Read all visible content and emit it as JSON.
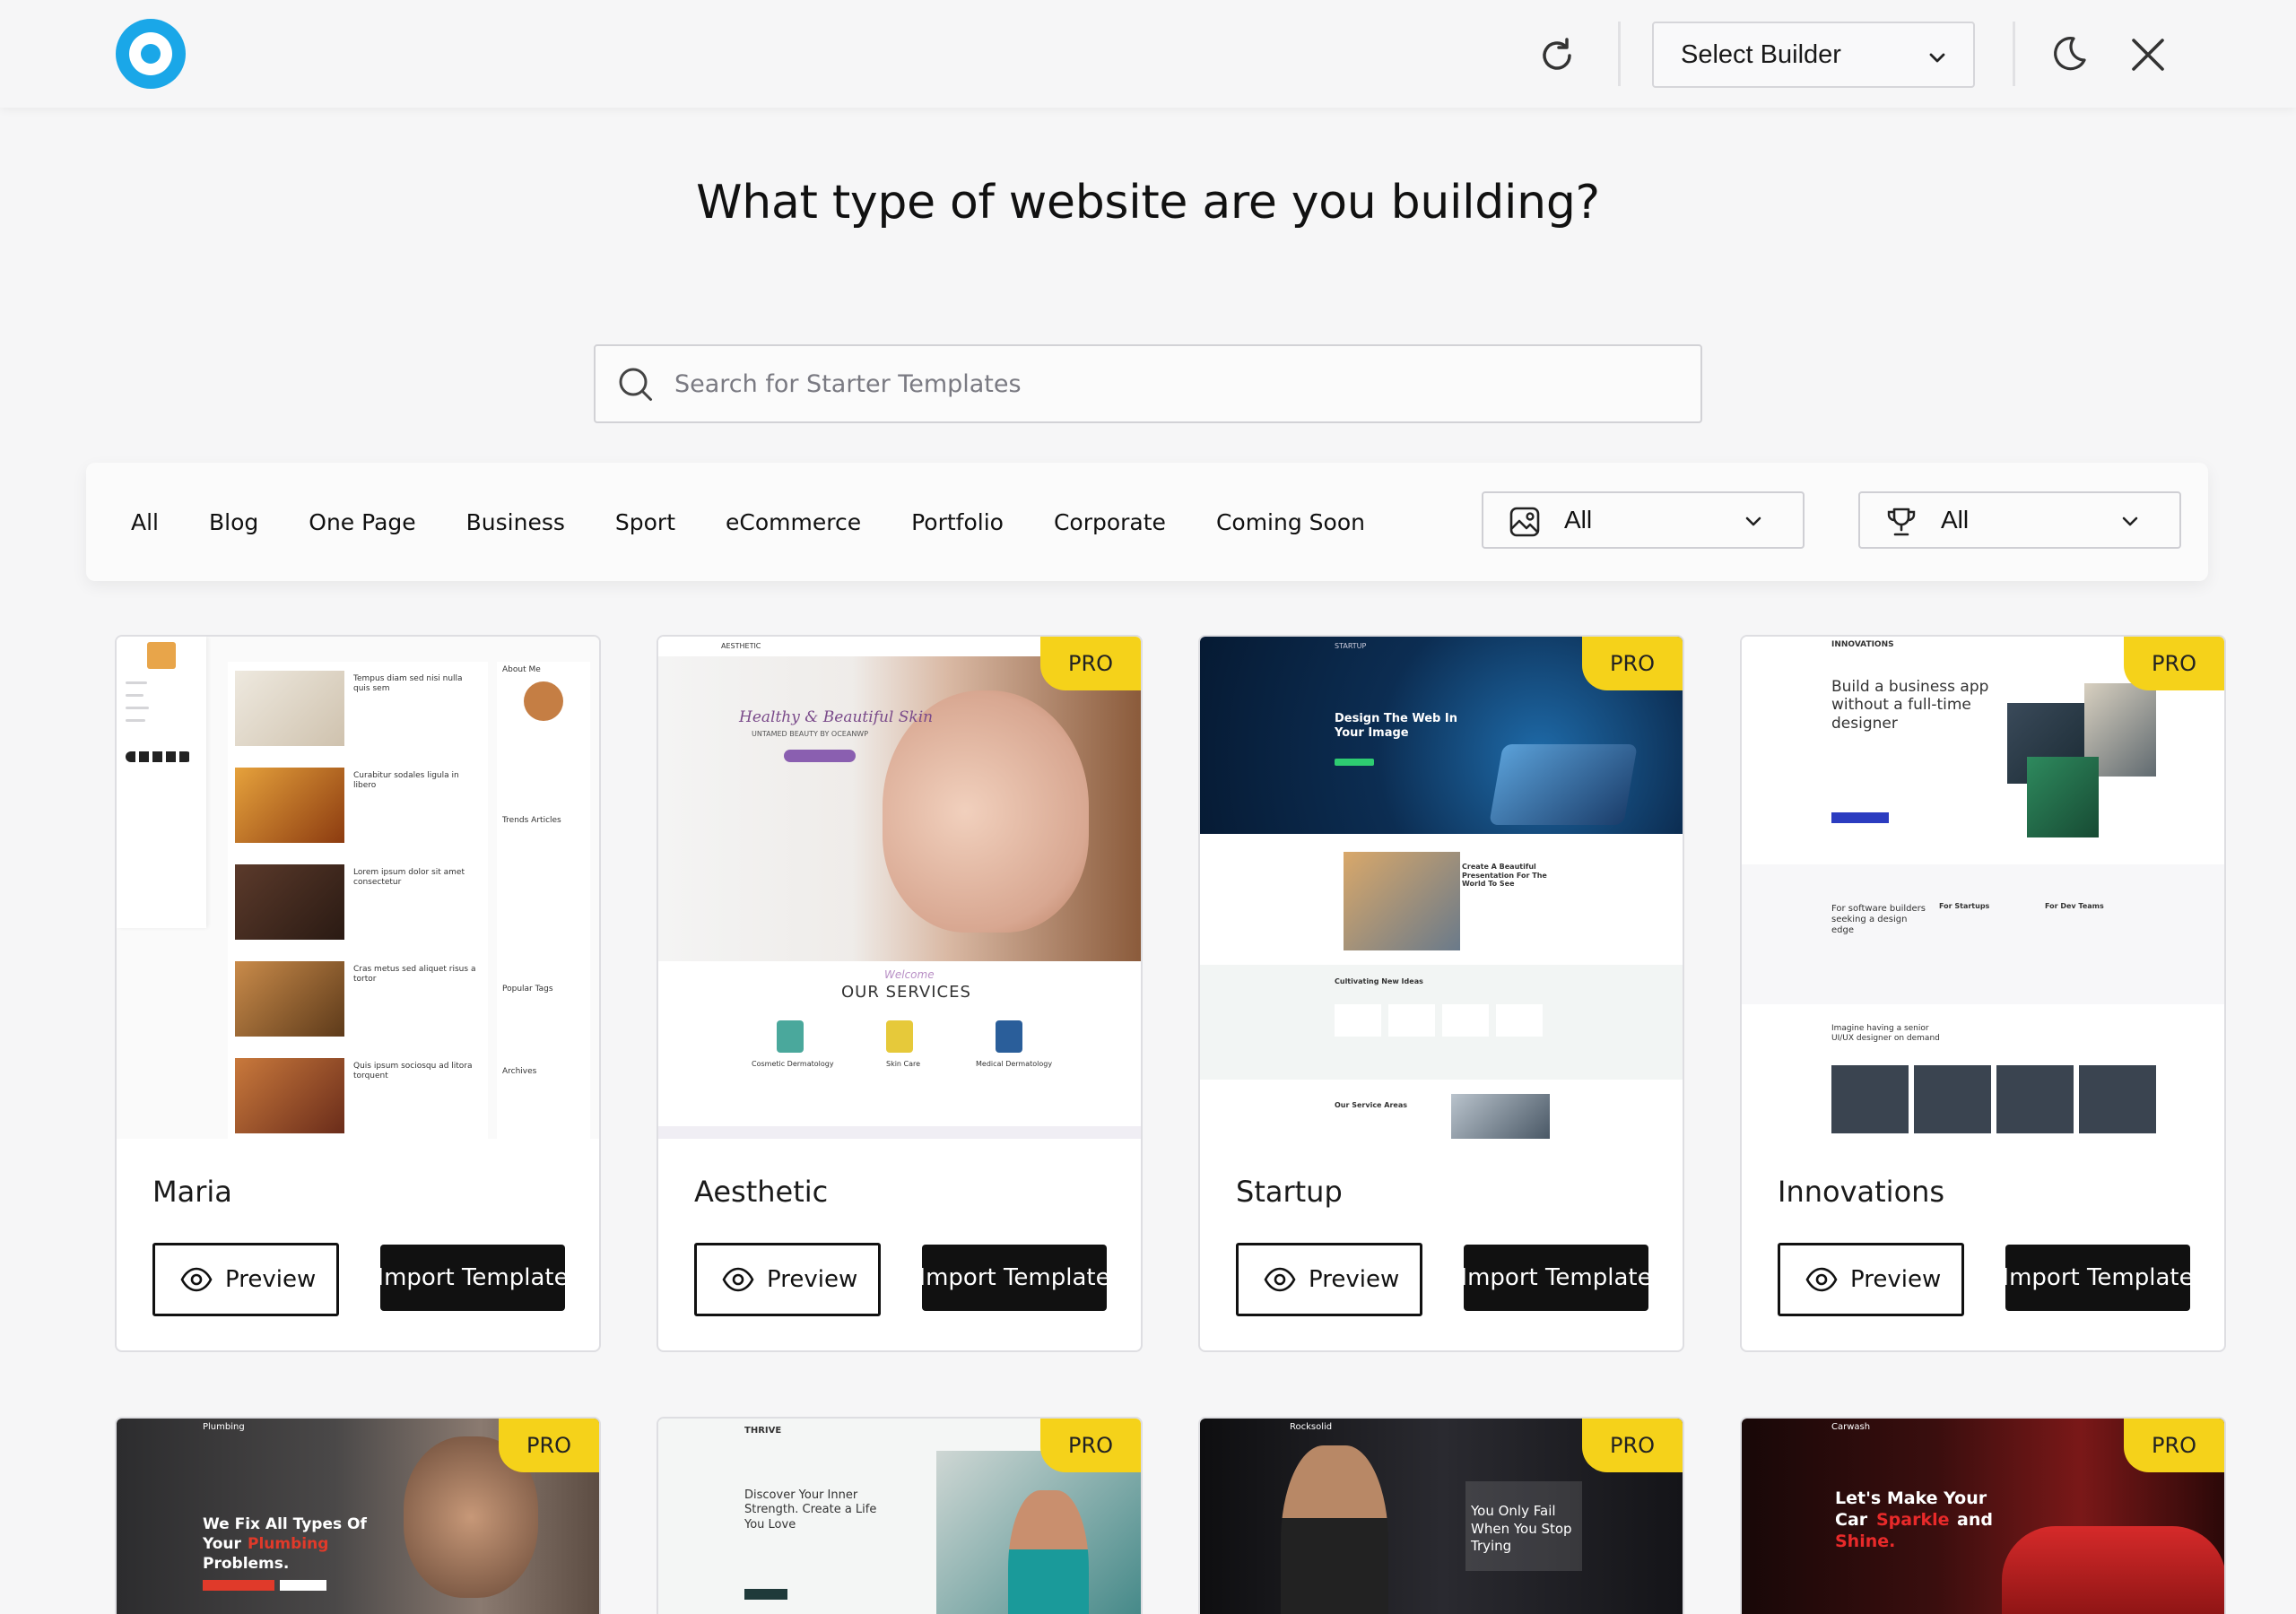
{
  "header": {
    "builder_select_label": "Select Builder"
  },
  "page": {
    "title": "What type of website are you building?"
  },
  "search": {
    "placeholder": "Search for Starter Templates"
  },
  "filters": {
    "categories": [
      "All",
      "Blog",
      "One Page",
      "Business",
      "Sport",
      "eCommerce",
      "Portfolio",
      "Corporate",
      "Coming Soon"
    ],
    "type_dropdown_value": "All",
    "tier_dropdown_value": "All"
  },
  "templates": [
    {
      "name": "Maria",
      "badge": "",
      "preview_label": "Preview",
      "import_label": "Import Template",
      "thumb_text": {
        "t1": "Tempus diam sed nisi nulla quis sem",
        "t2": "Curabitur sodales ligula in libero",
        "t3": "Lorem ipsum dolor sit amet consectetur",
        "t4": "Cras metus sed aliquet risus a tortor",
        "t5": "Quis ipsum sociosqu ad litora torquent",
        "s1": "About Me",
        "s2": "Trends Articles",
        "s3": "Popular Tags",
        "s4": "Archives"
      }
    },
    {
      "name": "Aesthetic",
      "badge": "PRO",
      "preview_label": "Preview",
      "import_label": "Import Template",
      "thumb_text": {
        "brand": "AESTHETIC",
        "hero1": "Healthy & Beautiful Skin",
        "hero2": "UNTAMED BEAUTY BY OCEANWP",
        "welcome": "Welcome",
        "services": "OUR SERVICES",
        "sv1": "Cosmetic Dermatology",
        "sv2": "Skin Care",
        "sv3": "Medical Dermatology"
      }
    },
    {
      "name": "Startup",
      "badge": "PRO",
      "preview_label": "Preview",
      "import_label": "Import Template",
      "thumb_text": {
        "brand": "STARTUP",
        "hero": "Design The Web In Your Image",
        "sec1": "Create A Beautiful Presentation For The World To See",
        "sec2": "Cultivating New Ideas",
        "sec3": "Our Service Areas"
      }
    },
    {
      "name": "Innovations",
      "badge": "PRO",
      "preview_label": "Preview",
      "import_label": "Import Template",
      "thumb_text": {
        "brand": "INNOVATIONS",
        "hero": "Build a business app without a full-time designer",
        "c1": "For software builders seeking a design edge",
        "c2": "For Startups",
        "c3": "For Dev Teams",
        "c4": "Imagine having a senior UI/UX designer on demand"
      }
    },
    {
      "name": "Plumbing",
      "badge": "PRO",
      "thumb_text": {
        "brand": "Plumbing",
        "hero1": "We Fix All Types Of",
        "hero2": "Your",
        "hero3": "Plumbing",
        "hero4": "Problems."
      }
    },
    {
      "name": "Thrive",
      "badge": "PRO",
      "thumb_text": {
        "brand": "THRIVE",
        "hero": "Discover Your Inner Strength. Create a Life You Love"
      }
    },
    {
      "name": "Rocksolid",
      "badge": "PRO",
      "thumb_text": {
        "brand": "Rocksolid",
        "hero": "You Only Fail When You Stop Trying"
      }
    },
    {
      "name": "Carwash",
      "badge": "PRO",
      "thumb_text": {
        "brand": "Carwash",
        "hero1": "Let's Make Your",
        "hero2": "Car",
        "hero3": "Sparkle",
        "hero4": "and",
        "hero5": "Shine."
      }
    }
  ],
  "colors": {
    "logo_blue": "#1aa7e8",
    "pro_badge": "#f5d21a",
    "import_button": "#111111",
    "background": "#f6f6f7"
  },
  "icons": {
    "logo": "target-logo-icon",
    "refresh": "refresh-icon",
    "moon": "moon-icon",
    "close": "close-icon",
    "search": "search-icon",
    "type_filter": "image-icon",
    "tier_filter": "trophy-icon",
    "preview": "eye-icon"
  }
}
